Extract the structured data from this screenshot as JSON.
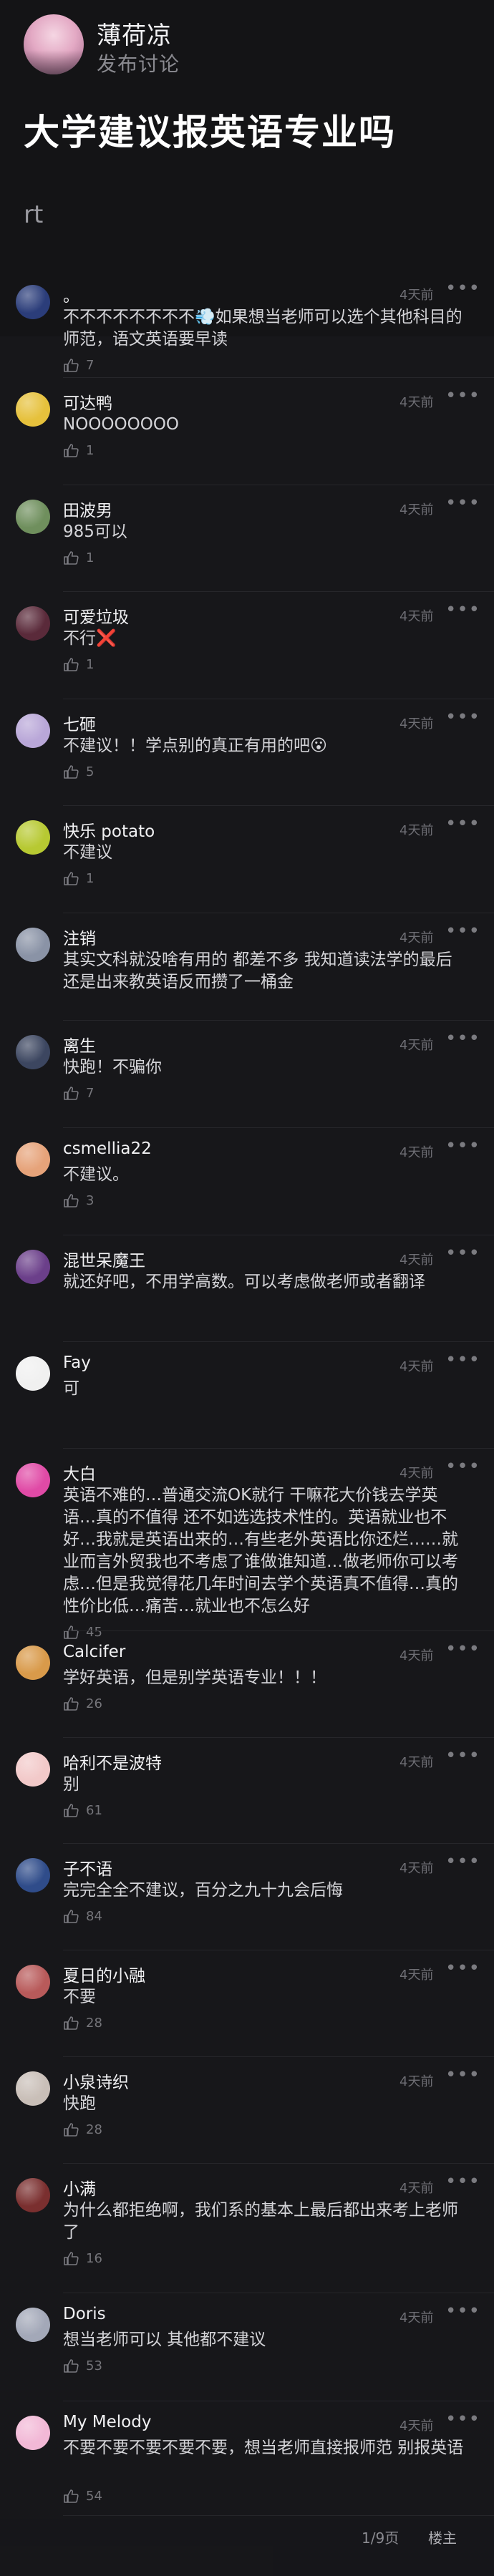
{
  "post": {
    "author": "薄荷凉",
    "subtitle": "发布讨论",
    "title": "大学建议报英语专业吗",
    "body": "rt"
  },
  "comments": [
    {
      "name": "。",
      "time": "4天前",
      "text": "不不不不不不不不💨如果想当老师可以选个其他科目的师范，语文英语要早读",
      "likes": "7",
      "avatar": "#2b3d7a"
    },
    {
      "name": "可达鸭",
      "time": "4天前",
      "text": "NOOOOOOOO",
      "likes": "1",
      "avatar": "#e6c13c"
    },
    {
      "name": "田波男",
      "time": "4天前",
      "text": "985可以",
      "likes": "1",
      "avatar": "#6f8f5d"
    },
    {
      "name": "可爱垃圾",
      "time": "4天前",
      "text": "不行❌",
      "likes": "1",
      "avatar": "#5a2a3a"
    },
    {
      "name": "七砸",
      "time": "4天前",
      "text": "不建议！！学点别的真正有用的吧😮",
      "likes": "5",
      "avatar": "#b9a7d8"
    },
    {
      "name": "快乐 potato",
      "time": "4天前",
      "text": "不建议",
      "likes": "1",
      "avatar": "#b7c932"
    },
    {
      "name": "注销",
      "time": "4天前",
      "text": "其实文科就没啥有用的 都差不多 我知道读法学的最后还是出来教英语反而攒了一桶金",
      "likes": "",
      "avatar": "#8a93a6"
    },
    {
      "name": "离生",
      "time": "4天前",
      "text": "快跑！不骗你",
      "likes": "7",
      "avatar": "#3c4660"
    },
    {
      "name": "csmellia22",
      "time": "4天前",
      "text": "不建议。",
      "likes": "3",
      "avatar": "#e6a37a"
    },
    {
      "name": "混世呆魔王",
      "time": "4天前",
      "text": "就还好吧，不用学高数。可以考虑做老师或者翻译",
      "likes": "",
      "avatar": "#6b3f8a"
    },
    {
      "name": "Fay",
      "time": "4天前",
      "text": "可",
      "likes": "",
      "avatar": "#f0f0f0"
    },
    {
      "name": "大白",
      "time": "4天前",
      "text": "英语不难的…普通交流OK就行 干嘛花大价钱去学英语…真的不值得 还不如选选技术性的。英语就业也不好…我就是英语出来的…有些老外英语比你还烂……就业而言外贸我也不考虑了谁做谁知道…做老师你可以考虑…但是我觉得花几年时间去学个英语真不值得…真的性价比低…痛苦…就业也不怎么好",
      "likes": "45",
      "avatar": "#e04aa6"
    },
    {
      "name": "Calcifer",
      "time": "4天前",
      "text": "学好英语，但是别学英语专业！！！",
      "likes": "26",
      "avatar": "#d99a4a"
    },
    {
      "name": "哈利不是波特",
      "time": "4天前",
      "text": "别",
      "likes": "61",
      "avatar": "#f2c9c9"
    },
    {
      "name": "子不语",
      "time": "4天前",
      "text": "完完全全不建议，百分之九十九会后悔",
      "likes": "84",
      "avatar": "#2f4c8a"
    },
    {
      "name": "夏日的小融",
      "time": "4天前",
      "text": "不要",
      "likes": "28",
      "avatar": "#b85a5a"
    },
    {
      "name": "小泉诗织",
      "time": "4天前",
      "text": "快跑",
      "likes": "28",
      "avatar": "#c9bfb8"
    },
    {
      "name": "小满",
      "time": "4天前",
      "text": "为什么都拒绝啊，我们系的基本上最后都出来考上老师了",
      "likes": "16",
      "avatar": "#7a2f2f"
    },
    {
      "name": "Doris",
      "time": "4天前",
      "text": "想当老师可以 其他都不建议",
      "likes": "53",
      "avatar": "#a3a8b8"
    },
    {
      "name": "My Melody",
      "time": "4天前",
      "text": "不要不要不要不要不要，想当老师直接报师范 别报英语",
      "likes": "54",
      "avatar": "#f2b8d6"
    }
  ],
  "pager": {
    "page": "1/9页",
    "louzhu": "楼主"
  }
}
